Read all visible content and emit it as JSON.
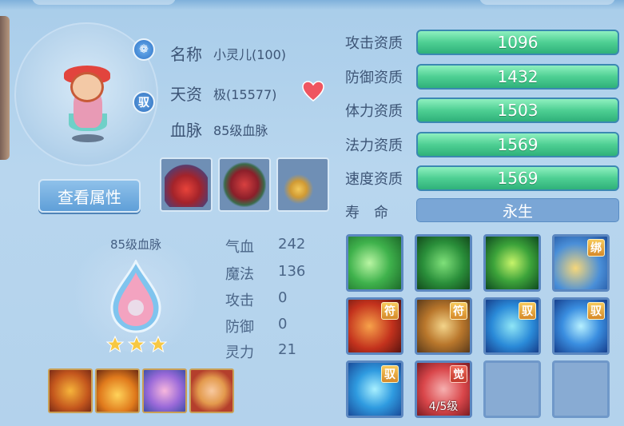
{
  "pet": {
    "name_label": "名称",
    "name_value": "小灵儿(100)",
    "talent_label": "天资",
    "talent_value": "极(15577)",
    "lineage_label": "血脉",
    "lineage_value": "85级血脉",
    "badge_yu": "驭"
  },
  "buttons": {
    "view_attr": "查看属性"
  },
  "lineage": {
    "title": "85级血脉",
    "stars": 3,
    "stats": [
      {
        "label": "气血",
        "value": "242"
      },
      {
        "label": "魔法",
        "value": "136"
      },
      {
        "label": "攻击",
        "value": "0"
      },
      {
        "label": "防御",
        "value": "0"
      },
      {
        "label": "灵力",
        "value": "21"
      }
    ]
  },
  "qualities": [
    {
      "label": "攻击资质",
      "value": "1096"
    },
    {
      "label": "防御资质",
      "value": "1432"
    },
    {
      "label": "体力资质",
      "value": "1503"
    },
    {
      "label": "法力资质",
      "value": "1569"
    },
    {
      "label": "速度资质",
      "value": "1569"
    }
  ],
  "life": {
    "label": "寿　命",
    "value": "永生"
  },
  "skills": [
    {
      "icon": "wings-skill-icon",
      "tag": ""
    },
    {
      "icon": "horse-skill-icon",
      "tag": ""
    },
    {
      "icon": "cross-skill-icon",
      "tag": ""
    },
    {
      "icon": "golden-wave-skill-icon",
      "tag": "绑"
    },
    {
      "icon": "fire-swirl-skill-icon",
      "tag": "符"
    },
    {
      "icon": "boot-skill-icon",
      "tag": "符"
    },
    {
      "icon": "wolf-skill-icon",
      "tag": "驭"
    },
    {
      "icon": "warrior-skill-icon",
      "tag": "驭"
    },
    {
      "icon": "shield-skill-icon",
      "tag": "驭"
    },
    {
      "icon": "awaken-skill-icon",
      "tag": "觉",
      "level": "4/5级"
    },
    {
      "icon": "empty-slot",
      "tag": ""
    },
    {
      "icon": "empty-slot",
      "tag": ""
    }
  ],
  "colors": {
    "accent_green": "#4ecf93",
    "tag_gold": "#e1a53b",
    "tag_red": "#c0392b"
  }
}
